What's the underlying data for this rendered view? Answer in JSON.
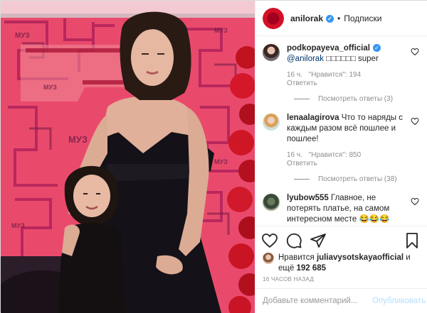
{
  "header": {
    "username": "anilorak",
    "verified_mark": "✓",
    "separator": "•",
    "follow_label": "Подписки"
  },
  "comments": [
    {
      "user": "podkopayeva_official",
      "verified": true,
      "mention": "@anilorak",
      "text": " □□□□□□ super",
      "time": "16 ч.",
      "likes": "\"Нравится\": 194",
      "reply": "Ответить",
      "view_replies": "Посмотреть ответы (3)"
    },
    {
      "user": "lenaalagirova",
      "verified": false,
      "mention": "",
      "text": "Что то наряды с каждым разом всё пошлее и пошлее!",
      "time": "16 ч.",
      "likes": "\"Нравится\": 850",
      "reply": "Ответить",
      "view_replies": "Посмотреть ответы (38)"
    },
    {
      "user": "lyubow555",
      "verified": false,
      "mention": "",
      "text": "Главное, не потерять платье, на самом интересном месте 😂😂😂",
      "time": "",
      "likes": "",
      "reply": "",
      "view_replies": ""
    }
  ],
  "actions": [
    "heart-icon",
    "comment-icon",
    "share-icon",
    "bookmark-icon"
  ],
  "likes": {
    "prefix": "Нравится ",
    "user": "juliavysotskayaofficial",
    "middle": " и ещё ",
    "count": "192 685"
  },
  "timestamp": "16 ЧАСОВ НАЗАД",
  "add_comment": {
    "placeholder": "Добавьте комментарий...",
    "post_label": "Опубликовать"
  },
  "colors": {
    "verified": "#3897f0",
    "link": "#003569",
    "muted": "#8e8e8e",
    "post_disabled": "#b2dffc",
    "photo_background": "#e9456a"
  }
}
